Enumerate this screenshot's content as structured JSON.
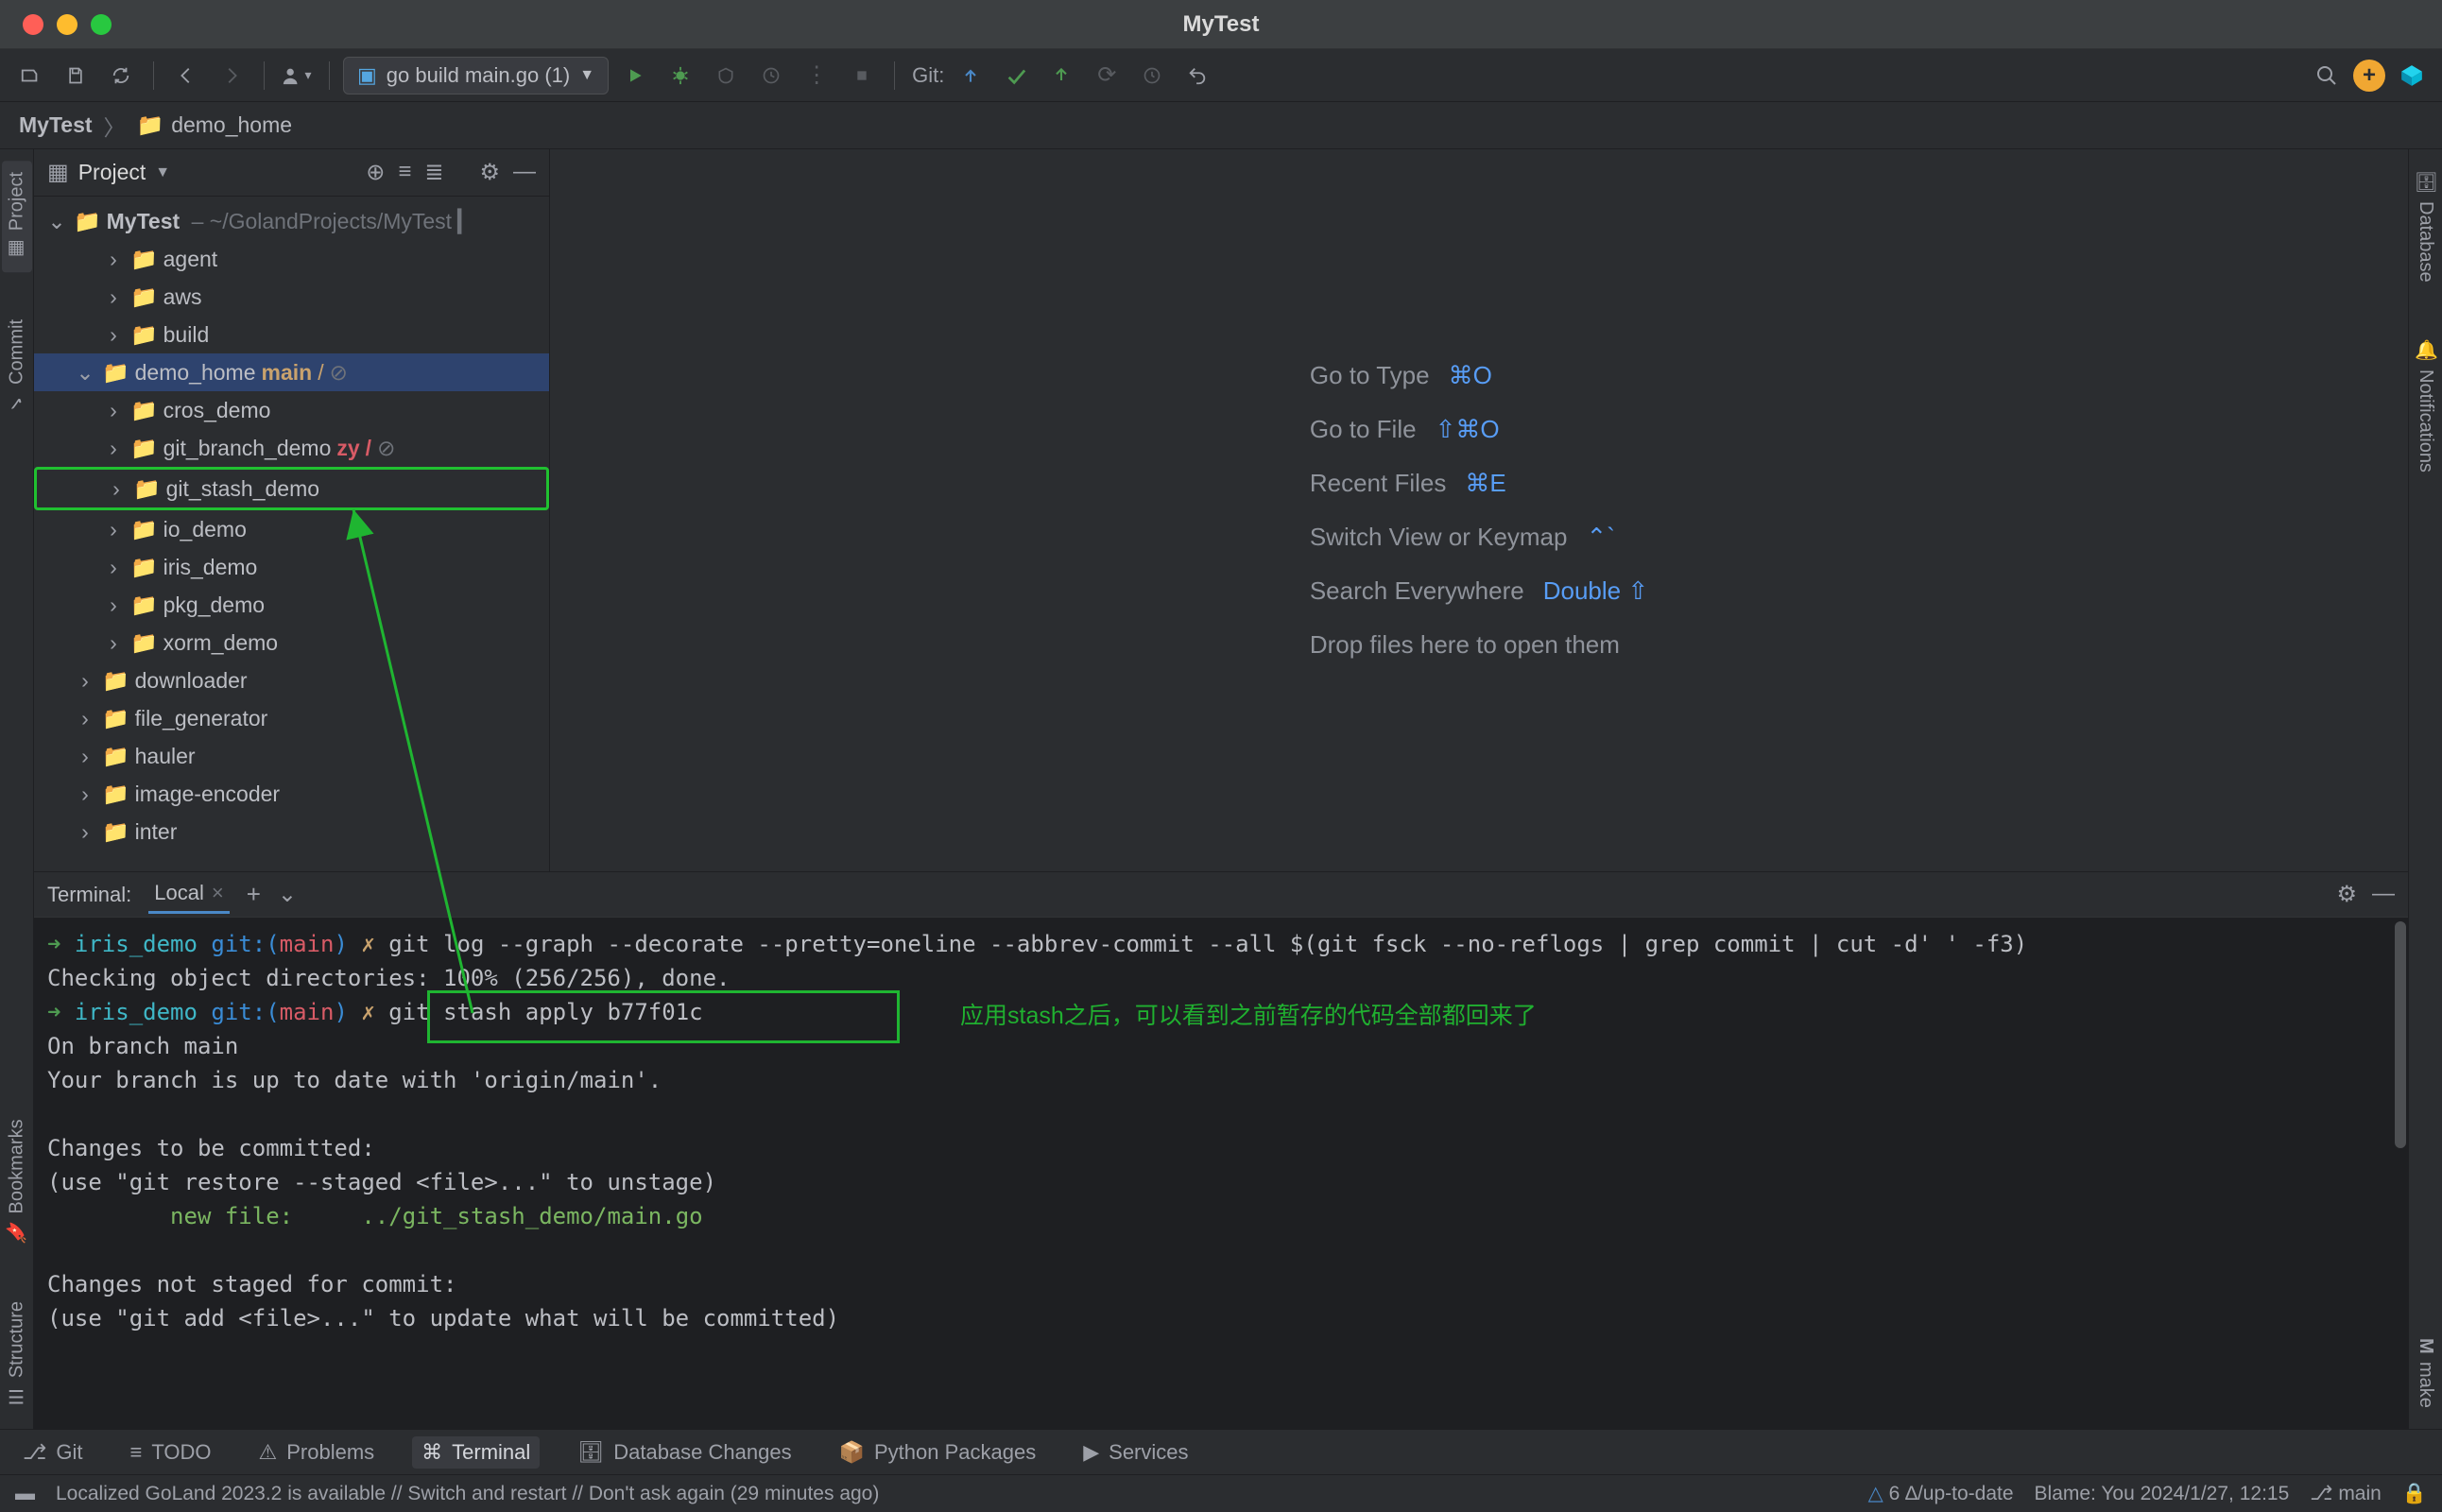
{
  "window": {
    "title": "MyTest"
  },
  "toolbar": {
    "run_config_label": "go build main.go (1)",
    "git_label": "Git:"
  },
  "breadcrumb": {
    "root": "MyTest",
    "child": "demo_home"
  },
  "gutters": {
    "left": [
      "Project",
      "Commit"
    ],
    "left_bottom": [
      "Bookmarks",
      "Structure"
    ],
    "right": [
      "Database",
      "Notifications"
    ],
    "right_bottom": [
      "make"
    ]
  },
  "project": {
    "header": "Project",
    "root": {
      "name": "MyTest",
      "path": " ~/GolandProjects/MyTest"
    },
    "items": [
      {
        "name": "agent",
        "depth": 2
      },
      {
        "name": "aws",
        "depth": 2
      },
      {
        "name": "build",
        "depth": 2
      },
      {
        "name": "demo_home",
        "depth": 1,
        "expanded": true,
        "selected": true,
        "branch": "main",
        "branch_icon": "stash"
      },
      {
        "name": "cros_demo",
        "depth": 2
      },
      {
        "name": "git_branch_demo",
        "depth": 2,
        "branch": "zy",
        "branch_icon": "stash",
        "zy": true
      },
      {
        "name": "git_stash_demo",
        "depth": 2,
        "boxed": true
      },
      {
        "name": "io_demo",
        "depth": 2
      },
      {
        "name": "iris_demo",
        "depth": 2
      },
      {
        "name": "pkg_demo",
        "depth": 2
      },
      {
        "name": "xorm_demo",
        "depth": 2
      },
      {
        "name": "downloader",
        "depth": 1
      },
      {
        "name": "file_generator",
        "depth": 1
      },
      {
        "name": "hauler",
        "depth": 1
      },
      {
        "name": "image-encoder",
        "depth": 1
      },
      {
        "name": "inter",
        "depth": 1
      }
    ]
  },
  "editor_hints": [
    {
      "label": "Go to Type",
      "kbd": "⌘O"
    },
    {
      "label": "Go to File",
      "kbd": "⇧⌘O"
    },
    {
      "label": "Recent Files",
      "kbd": "⌘E"
    },
    {
      "label": "Switch View or Keymap",
      "kbd": "⌃`"
    },
    {
      "label": "Search Everywhere",
      "kbd": "Double ⇧"
    },
    {
      "label": "Drop files here to open them",
      "kbd": ""
    }
  ],
  "terminal": {
    "title": "Terminal:",
    "tab": "Local",
    "prompt_dir": "iris_demo",
    "prompt_git": "git:",
    "prompt_branch": "main",
    "lines": {
      "cmd1": "git log --graph --decorate --pretty=oneline --abbrev-commit --all $(git fsck --no-reflogs | grep commit | cut -d' ' -f3)",
      "out1": "Checking object directories: 100% (256/256), done.",
      "cmd2": "git stash apply b77f01c",
      "out2": "On branch main",
      "out3": "Your branch is up to date with 'origin/main'.",
      "out4": "Changes to be committed:",
      "out5": "  (use \"git restore --staged <file>...\" to unstage)",
      "out6_a": "new file:",
      "out6_b": "../git_stash_demo/main.go",
      "out7": "Changes not staged for commit:",
      "out8": "  (use \"git add <file>...\" to update what will be committed)"
    },
    "annotation": "应用stash之后，可以看到之前暂存的代码全部都回来了"
  },
  "bottom_tabs": [
    {
      "label": "Git",
      "icon": "branch"
    },
    {
      "label": "TODO",
      "icon": "list"
    },
    {
      "label": "Problems",
      "icon": "warn"
    },
    {
      "label": "Terminal",
      "icon": "term",
      "active": true
    },
    {
      "label": "Database Changes",
      "icon": "db"
    },
    {
      "label": "Python Packages",
      "icon": "pkg"
    },
    {
      "label": "Services",
      "icon": "play"
    }
  ],
  "statusbar": {
    "message": "Localized GoLand 2023.2 is available // Switch and restart // Don't ask again (29 minutes ago)",
    "right1": "6 ∆/up-to-date",
    "right2": "Blame: You 2024/1/27, 12:15",
    "right3": "main"
  }
}
